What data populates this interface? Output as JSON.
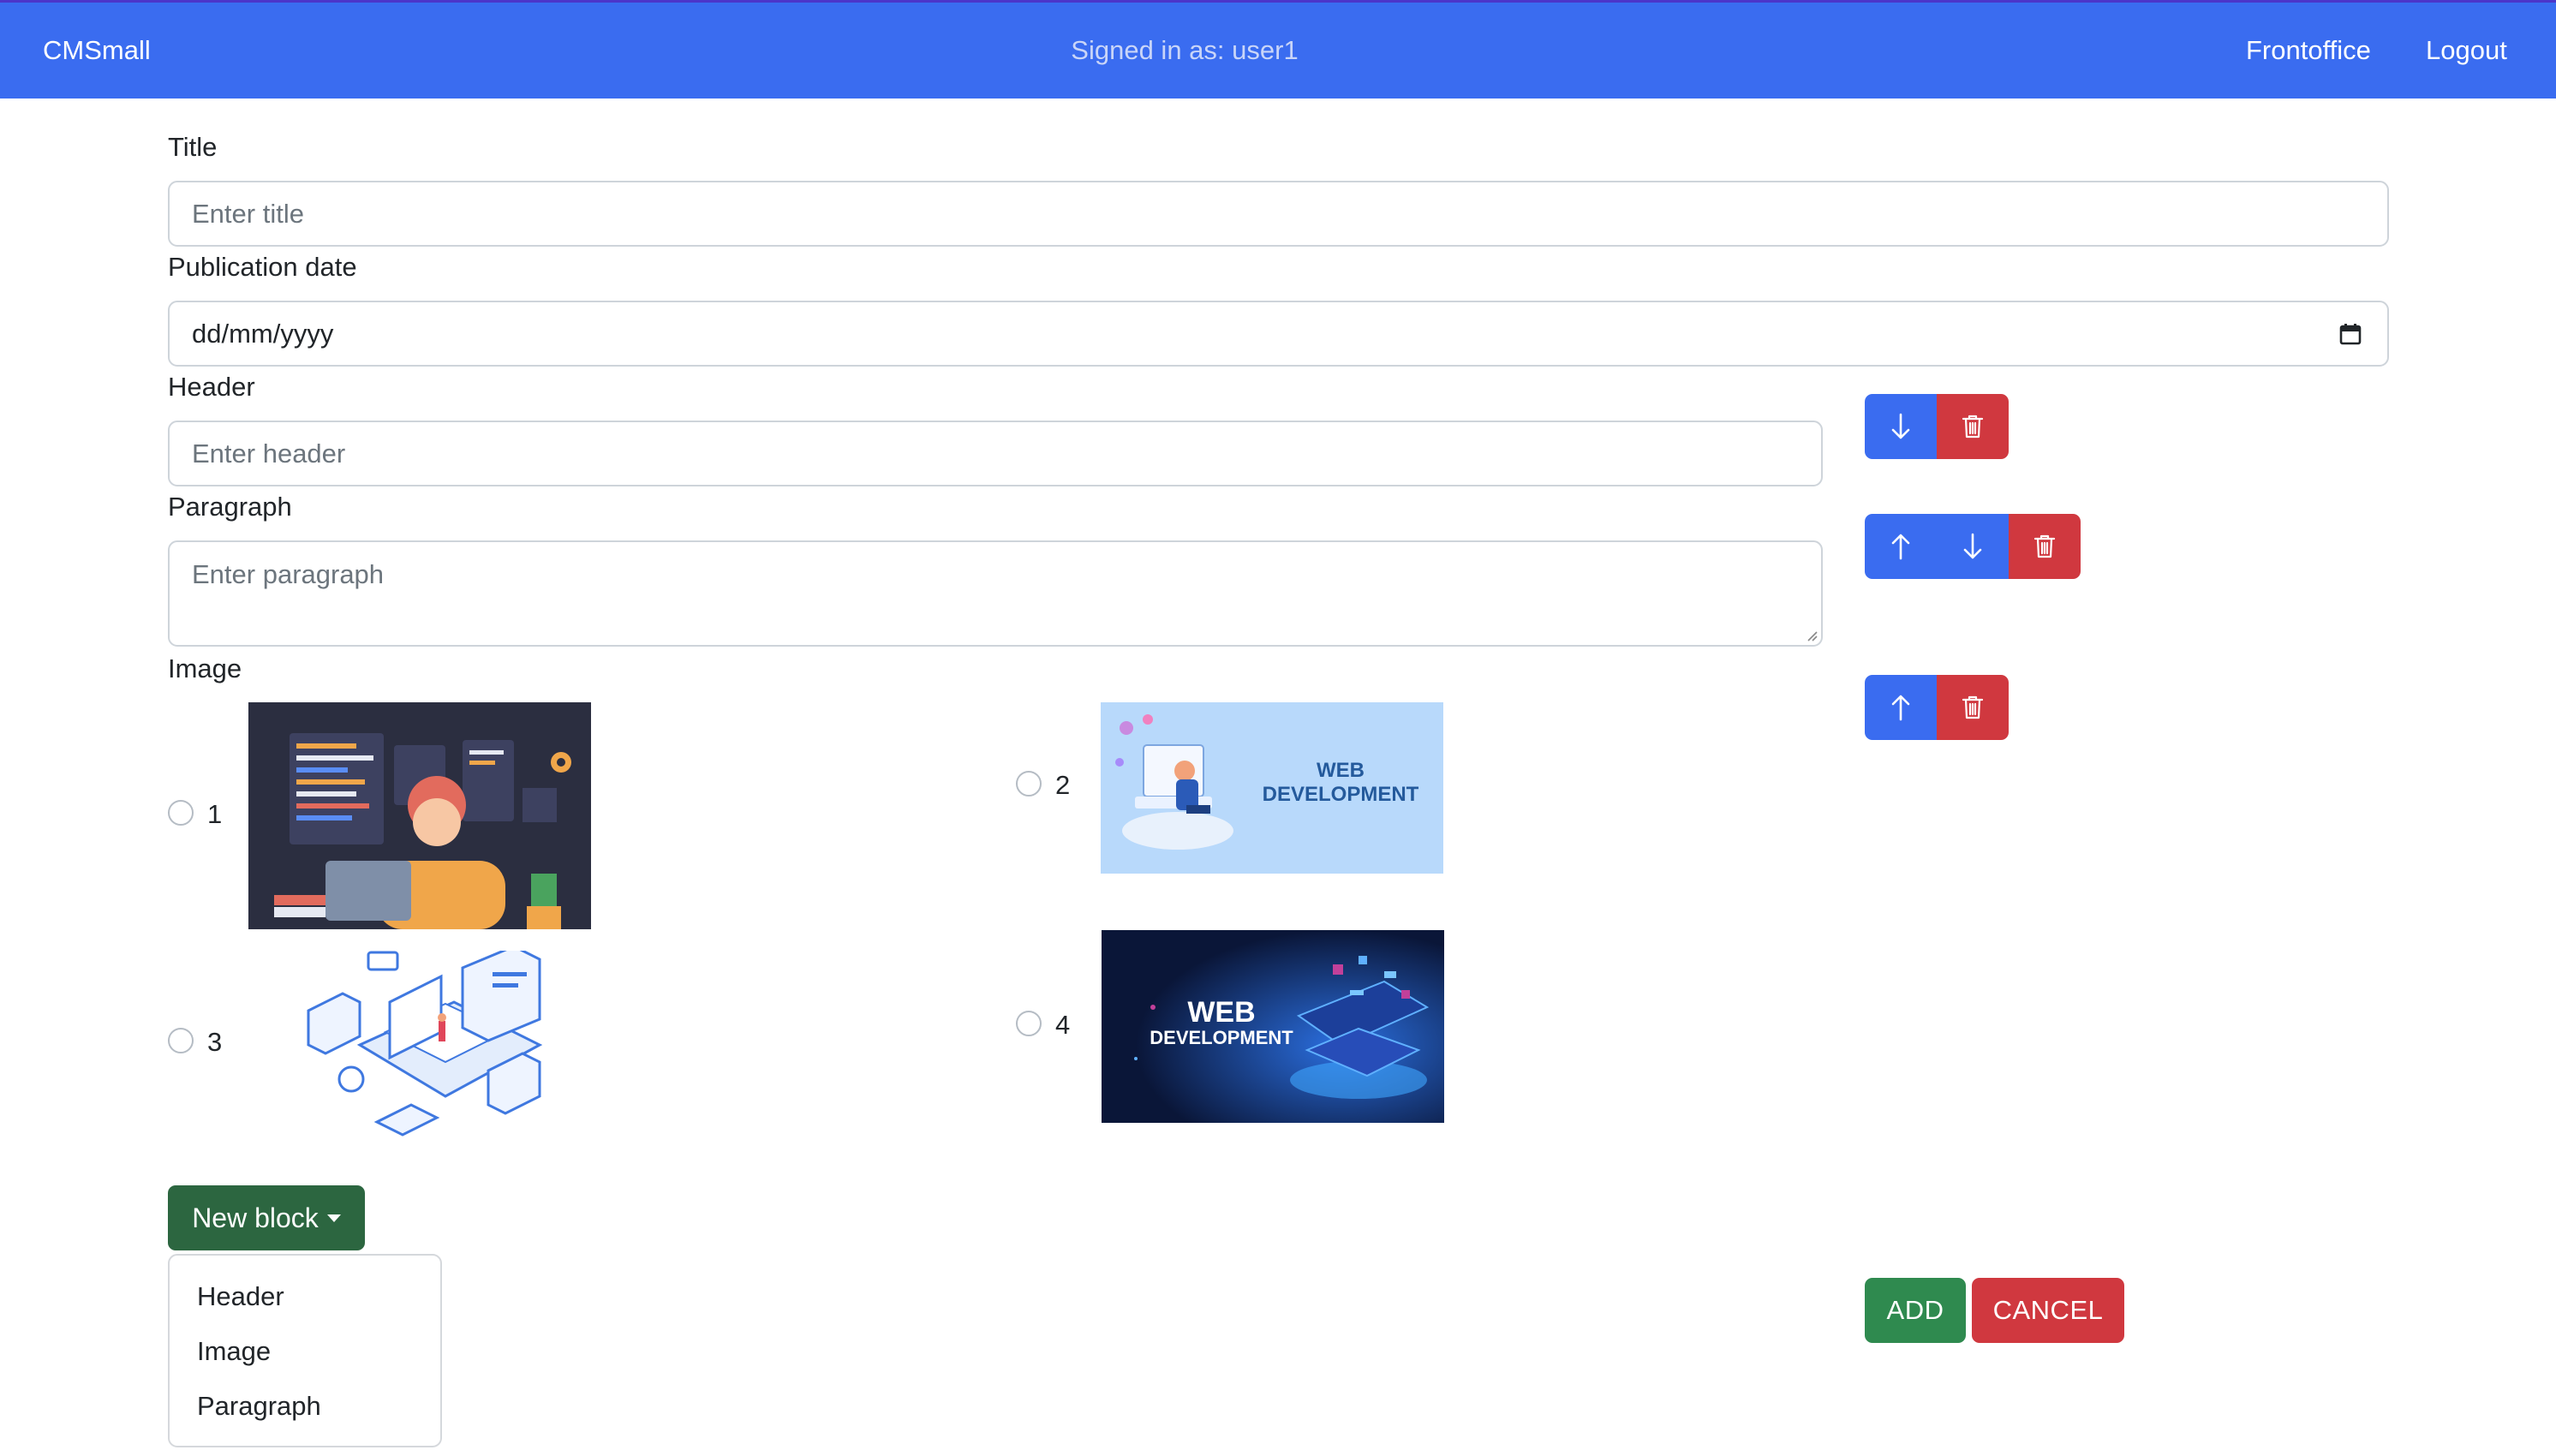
{
  "navbar": {
    "brand": "CMSmall",
    "signed_in": "Signed in as: user1",
    "frontoffice": "Frontoffice",
    "logout": "Logout"
  },
  "form": {
    "title_label": "Title",
    "title_placeholder": "Enter title",
    "date_label": "Publication date",
    "date_value": "dd/mm/yyyy"
  },
  "blocks": {
    "header_label": "Header",
    "header_placeholder": "Enter header",
    "paragraph_label": "Paragraph",
    "paragraph_placeholder": "Enter paragraph",
    "image_label": "Image",
    "image_options": [
      {
        "num": "1",
        "caption": ""
      },
      {
        "num": "2",
        "caption": "WEB\nDEVELOPMENT"
      },
      {
        "num": "3",
        "caption": ""
      },
      {
        "num": "4",
        "caption": "WEB\nDEVELOPMENT"
      }
    ]
  },
  "thumb_text": {
    "img2_line1": "WEB",
    "img2_line2": "DEVELOPMENT",
    "img4_line1": "WEB",
    "img4_line2": "DEVELOPMENT"
  },
  "new_block": {
    "label": "New block",
    "items": [
      "Header",
      "Image",
      "Paragraph"
    ]
  },
  "actions": {
    "add": "ADD",
    "cancel": "CANCEL"
  },
  "colors": {
    "primary": "#3a6cf0",
    "danger": "#d0383f",
    "success": "#2f8a4f",
    "dark_success": "#2c6640"
  },
  "icons": {
    "down": "arrow-down-icon",
    "up": "arrow-up-icon",
    "delete": "trash-icon",
    "calendar": "calendar-icon"
  }
}
